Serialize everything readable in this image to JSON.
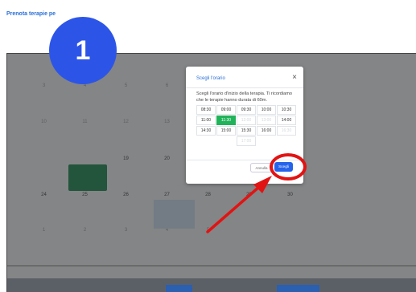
{
  "app": {
    "title": "Prenota terapie pe"
  },
  "annotation": {
    "step_number": "1"
  },
  "calendar": {
    "rows": [
      [
        "3",
        "4",
        "5",
        "6",
        "",
        "",
        ""
      ],
      [
        "10",
        "11",
        "12",
        "13",
        "",
        "",
        ""
      ],
      [
        "",
        "",
        "19",
        "20",
        "",
        "",
        ""
      ],
      [
        "24",
        "25",
        "26",
        "27",
        "28",
        "29",
        "30"
      ],
      [
        "1",
        "2",
        "3",
        "4",
        "5",
        "",
        ""
      ]
    ]
  },
  "modal": {
    "title": "Scegli l'orario",
    "close": "×",
    "instructions": "Scegli l'orario d'inizio della terapia. Ti ricordiamo che le terapie hanno durata di 60m.",
    "slots": [
      [
        "08:30",
        "09:00",
        "09:30",
        "10:00",
        "10:30"
      ],
      [
        "11:00",
        "11:30",
        "12:00",
        "13:00",
        "14:00"
      ],
      [
        "14:30",
        "15:00",
        "15:30",
        "16:00",
        "16:30"
      ],
      [
        "",
        "",
        "17:00",
        "",
        ""
      ]
    ],
    "selected_slot": "11:30",
    "cancel_label": "Annulla",
    "choose_label": "Scegli"
  },
  "colors": {
    "accent": "#2563eb",
    "selected": "#21b35a",
    "annotation_red": "#e21313"
  }
}
